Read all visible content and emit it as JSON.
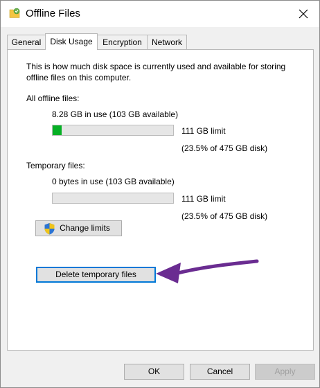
{
  "window": {
    "title": "Offline Files",
    "icon": "offline-files-folder-icon"
  },
  "tabs": [
    {
      "label": "General",
      "active": false
    },
    {
      "label": "Disk Usage",
      "active": true
    },
    {
      "label": "Encryption",
      "active": false
    },
    {
      "label": "Network",
      "active": false
    }
  ],
  "description": "This is how much disk space is currently used and available for storing offline files on this computer.",
  "offline_files": {
    "heading": "All offline files:",
    "usage": "8.28 GB in use (103 GB available)",
    "limit": "111 GB limit",
    "limit_detail": "(23.5% of 475 GB disk)",
    "usage_fraction": 0.075
  },
  "temporary_files": {
    "heading": "Temporary files:",
    "usage": "0 bytes in use (103 GB available)",
    "limit": "111 GB limit",
    "limit_detail": "(23.5% of 475 GB disk)",
    "usage_fraction": 0
  },
  "buttons": {
    "change_limits": "Change limits",
    "delete_temp": "Delete temporary files",
    "ok": "OK",
    "cancel": "Cancel",
    "apply": "Apply"
  },
  "colors": {
    "progress_fill": "#06b025",
    "focus_border": "#0078d7",
    "annotation_arrow": "#6a2c91"
  }
}
